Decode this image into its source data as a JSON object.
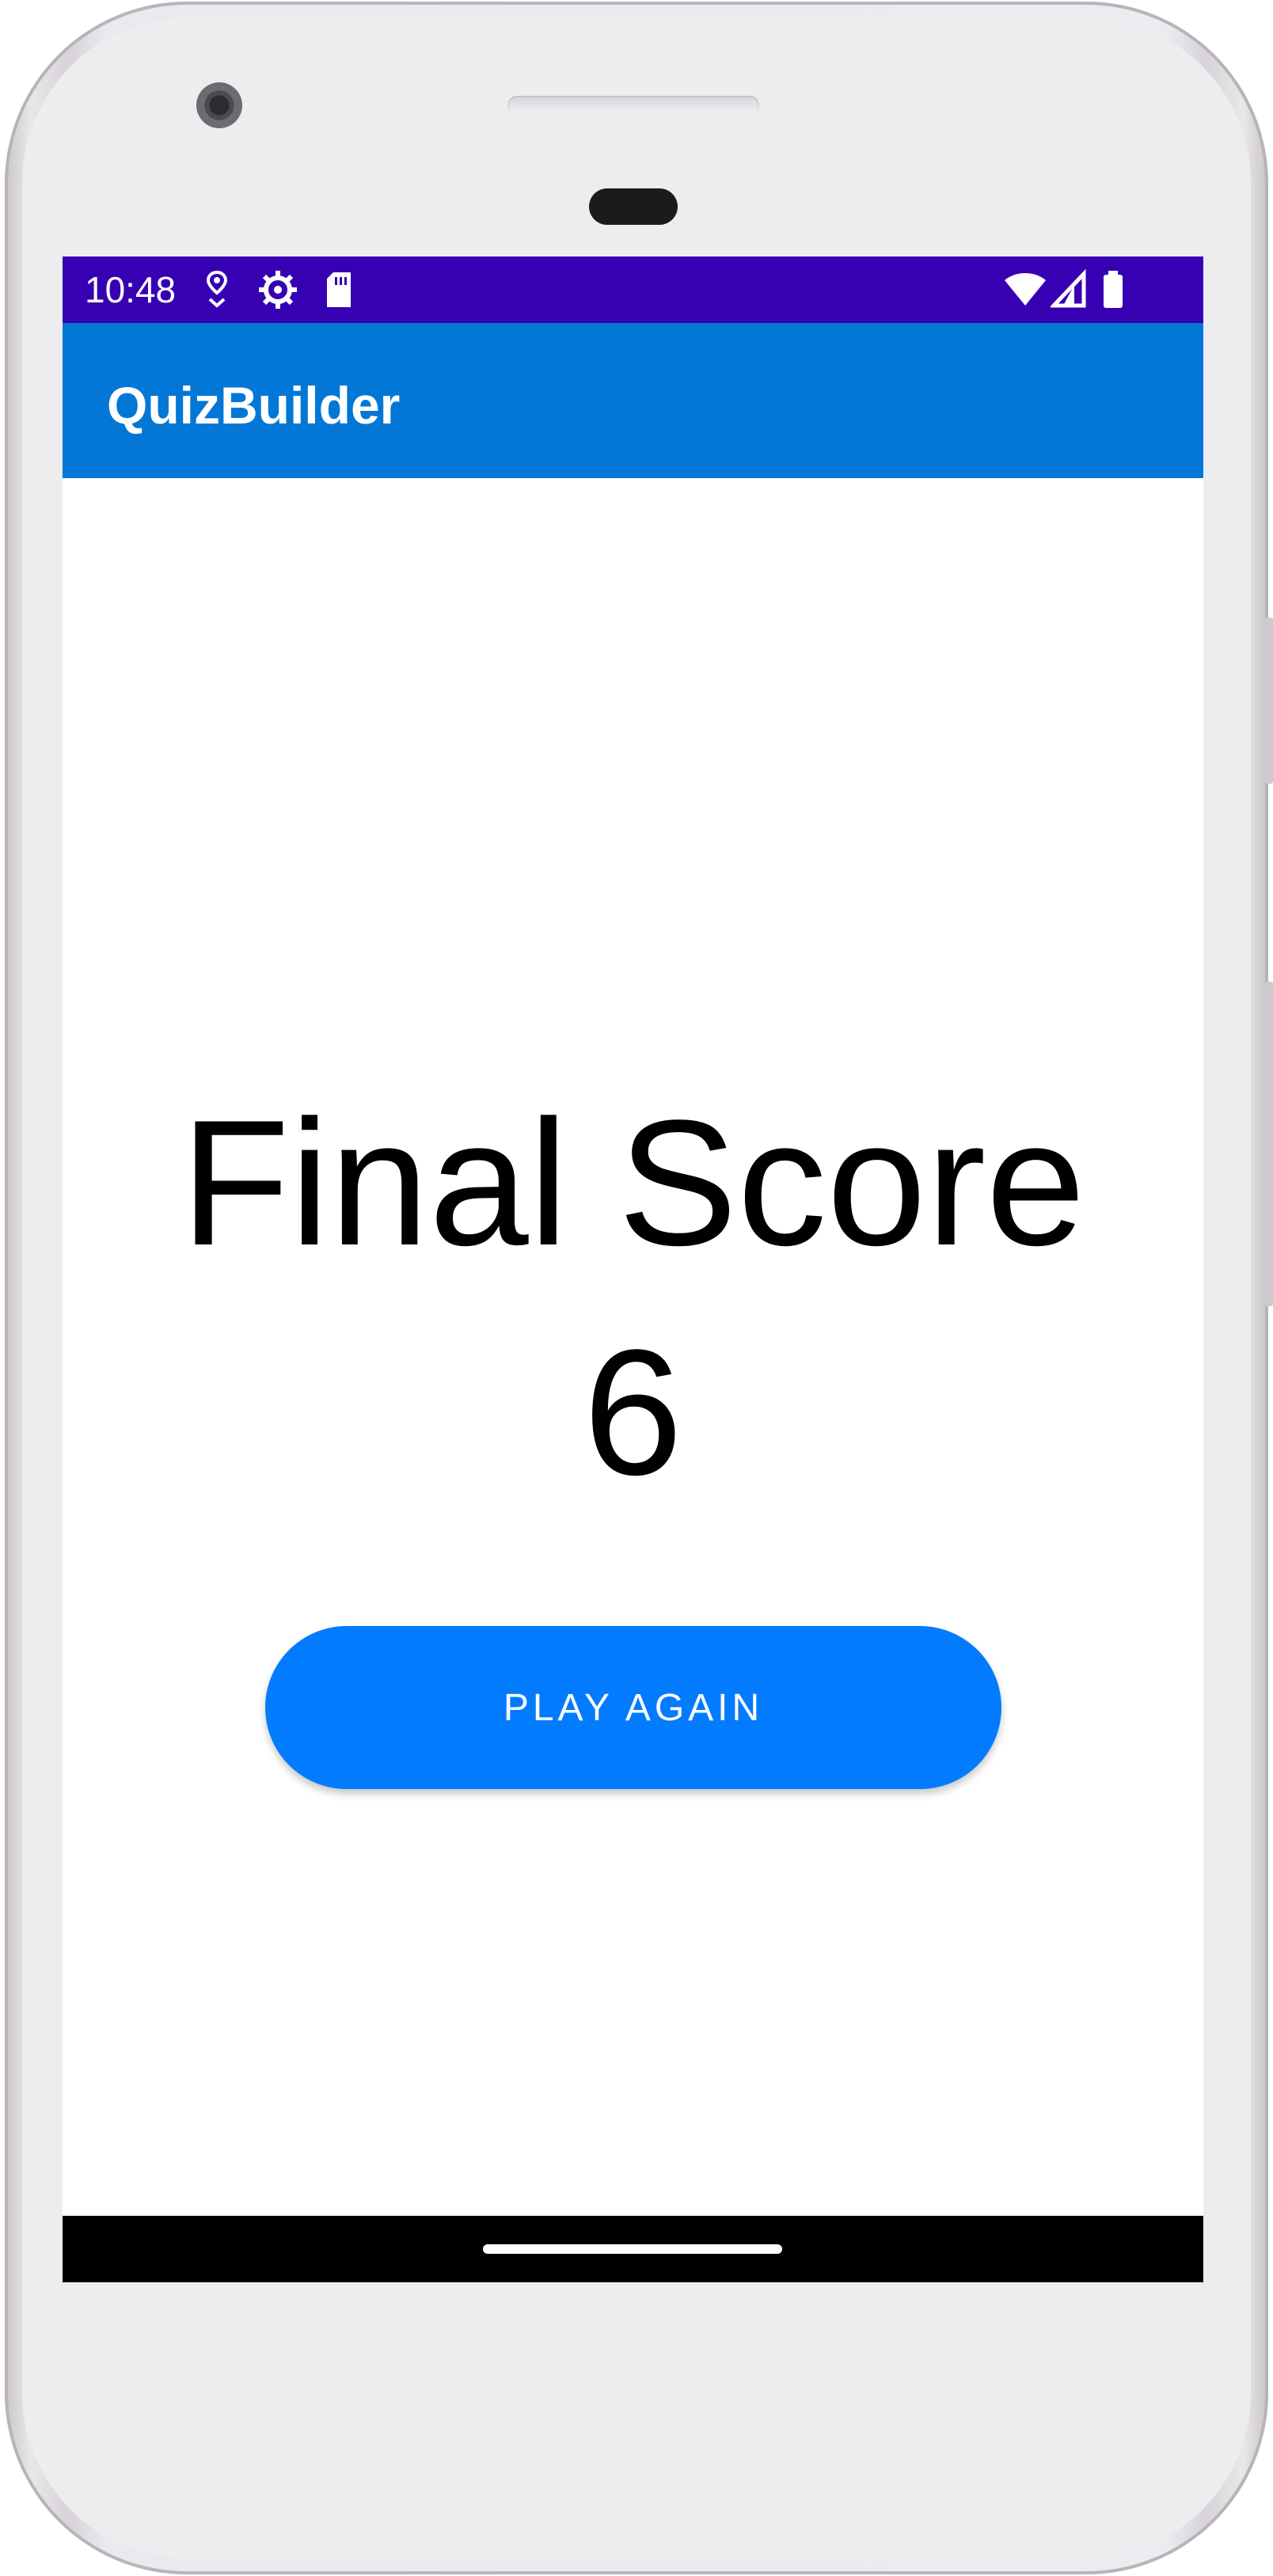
{
  "status_bar": {
    "time": "10:48",
    "left_icons": [
      "location-pin-icon",
      "settings-gear-icon",
      "sd-card-icon"
    ],
    "right_icons": [
      "wifi-icon",
      "cellular-signal-icon",
      "battery-icon"
    ]
  },
  "app_bar": {
    "title": "QuizBuilder"
  },
  "score": {
    "heading": "Final Score",
    "value": "6"
  },
  "play_again_button": {
    "label": "PLAY AGAIN"
  },
  "colors": {
    "status_bar": "#3700b3",
    "app_bar": "#0277d6",
    "button": "#027bff",
    "button_text": "#ffffff",
    "score_text": "#000000",
    "nav_bar": "#000000"
  }
}
